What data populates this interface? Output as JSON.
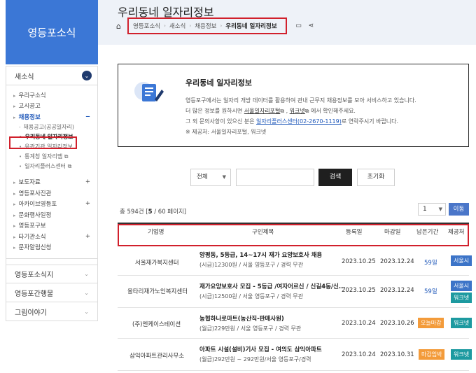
{
  "sidebar": {
    "title": "영등포소식",
    "section": "새소식",
    "items": [
      {
        "label": "우리구소식",
        "mark": ""
      },
      {
        "label": "고시공고",
        "mark": ""
      },
      {
        "label": "채용정보",
        "mark": "−"
      }
    ],
    "subitems": [
      "채용공고(공공일자리)",
      "우리동네 일자리정보",
      "유관기관 일자리정보",
      "통계청 일자리맵 ⧉",
      "일자리플러스센터 ⧉"
    ],
    "items2": [
      {
        "label": "보도자료",
        "mark": "+"
      },
      {
        "label": "영등포사진관",
        "mark": ""
      },
      {
        "label": "아카이브영등포",
        "mark": "+"
      },
      {
        "label": "문화행사일정",
        "mark": ""
      },
      {
        "label": "영등포구보",
        "mark": ""
      },
      {
        "label": "타기관소식",
        "mark": "+"
      },
      {
        "label": "문자알림신청",
        "mark": ""
      }
    ],
    "groups": [
      "영등포소식지",
      "영등포간행물",
      "그림이야기"
    ]
  },
  "header": {
    "title": "우리동네 일자리정보",
    "breadcrumb": [
      "영등포소식",
      "새소식",
      "채용정보",
      "우리동네 일자리정보"
    ]
  },
  "info": {
    "title": "우리동네 일자리정보",
    "line1": "영등포구에서는 일자리 개방 데이터를 활용하여 관내 근무지 채용정보를 모아 서비스하고 있습니다.",
    "line2_pre": "더 많은 정보를 원하시면 ",
    "line2_link1": "서울일자리포털",
    "line2_sep": "⧉ , ",
    "line2_link2": "워크넷",
    "line2_post": "⧉ 에서 확인해주세요.",
    "line3_pre": "그 외 문의사항이 있으신 분은 ",
    "line3_link": "일자리플러스센터(02-2670-1119)",
    "line3_post": "로 연락주시기 바랍니다.",
    "line4": "※ 제공처: 서울일자리포털, 워크넷"
  },
  "search": {
    "select": "전체",
    "search_label": "검색",
    "reset_label": "초기화"
  },
  "list": {
    "total_pre": "총 594건 [",
    "page": "5",
    "total_post": " / 60 페이지]",
    "page_select": "1",
    "go_label": "이동"
  },
  "table": {
    "headers": [
      "기업명",
      "구인제목",
      "등록일",
      "마감일",
      "남은기간",
      "제공처"
    ],
    "rows": [
      {
        "org": "서울재가복지센터",
        "title": "양평동, 5등급, 14~17시 재가 요양보호사 채용",
        "sub": "(시급)12300원 / 서울 영등포구 / 경력 무관",
        "reg": "2023.10.25",
        "end": "2023.12.24",
        "remain": "59일",
        "remain_style": "text",
        "providers": [
          "서울시"
        ]
      },
      {
        "org": "올타리재가노인복지센터",
        "title": "재가요양보호사 모집 - 5등급 /여자어르신 / 신길4동/신...",
        "sub": "(시급)12500원 / 서울 영등포구 / 경력 무관",
        "reg": "2023.10.25",
        "end": "2023.12.24",
        "remain": "59일",
        "remain_style": "text",
        "providers": [
          "서울시",
          "워크넷"
        ]
      },
      {
        "org": "(주)엔케이스테이션",
        "title": "농협하나로마트(농산직-판매사원)",
        "sub": "(월급)229만원 / 서울 영등포구 / 경력 무관",
        "reg": "2023.10.24",
        "end": "2023.10.26",
        "remain": "오늘마감",
        "remain_style": "badge",
        "providers": [
          "워크넷"
        ]
      },
      {
        "org": "삼익아파트관리사무소",
        "title": "아파트 시설(설비)기사 모집 - 여의도 삼익아파트",
        "sub": "(월급)292만원 ~ 292만원/서울 영등포구/경력",
        "reg": "2023.10.24",
        "end": "2023.10.31",
        "remain": "마감임박",
        "remain_style": "badge",
        "providers": [
          "워크넷"
        ]
      }
    ]
  },
  "colors": {
    "accent": "#3b77d6",
    "highlight": "#d1202c",
    "badge_blue": "#3c74c8",
    "badge_teal": "#1d9aa0",
    "badge_orange": "#f39b3a"
  }
}
